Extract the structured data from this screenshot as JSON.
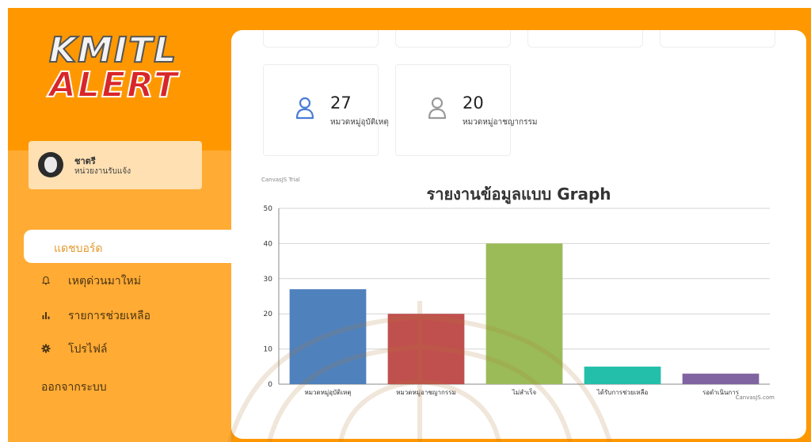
{
  "logo": {
    "line1": "KMITL",
    "line2": "ALERT"
  },
  "user": {
    "name": "ชาตรี",
    "role": "หน่วยงานรับแจ้ง",
    "avatar": "cat-avatar"
  },
  "nav": {
    "active": "แดชบอร์ด",
    "items": [
      {
        "label": "เหตุด่วนมาใหม่",
        "icon": "bell-icon"
      },
      {
        "label": "รายการช่วยเหลือ",
        "icon": "bar-chart-icon"
      },
      {
        "label": "โปรไฟล์",
        "icon": "gear-icon"
      }
    ],
    "logout": "ออกจากระบบ"
  },
  "stats": [
    {
      "value": "27",
      "label": "หมวดหมู่อุบัติเหตุ",
      "icon": "user-icon",
      "color": "#4a7bd6"
    },
    {
      "value": "20",
      "label": "หมวดหมู่อาชญากรรม",
      "icon": "user-icon",
      "color": "#9a9a9a"
    }
  ],
  "chart_credit_top": "CanvasJS Trial",
  "chart_credit_bottom": "CanvasJS.com",
  "colors": {
    "sidebar": "#ff9800",
    "sidebar_lower": "#ffab34",
    "user_card": "#ffe0b2",
    "active_nav_text": "#e49a2c"
  },
  "chart_data": {
    "type": "bar",
    "title": "รายงานข้อมูลแบบ Graph",
    "categories": [
      "หมวดหมู่อุบัติเหตุ",
      "หมวดหมู่อาชญากรรม",
      "ไม่สำเร็จ",
      "ได้รับการช่วยเหลือ",
      "รอดำเนินการ"
    ],
    "values": [
      27,
      20,
      40,
      5,
      3
    ],
    "colors": [
      "#4f81bc",
      "#c0504e",
      "#9bbb58",
      "#23bfaa",
      "#8064a1"
    ],
    "ylim": [
      0,
      50
    ],
    "yticks": [
      0,
      10,
      20,
      30,
      40,
      50
    ],
    "grid": true,
    "xlabel": "",
    "ylabel": ""
  }
}
